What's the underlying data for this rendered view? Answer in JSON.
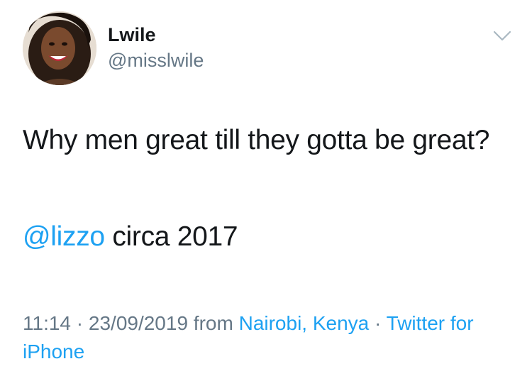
{
  "user": {
    "display_name": "Lwile",
    "handle": "@misslwile"
  },
  "tweet": {
    "text": "Why men great till they gotta be great?",
    "mention": "@lizzo",
    "mention_suffix": " circa 2017"
  },
  "meta": {
    "time": "11:14",
    "separator1": " · ",
    "date": "23/09/2019",
    "from_label": " from ",
    "location": "Nairobi, Kenya",
    "separator2": " · ",
    "client": "Twitter for iPhone"
  },
  "icons": {
    "menu": "chevron-down-icon"
  },
  "colors": {
    "text": "#14171a",
    "secondary": "#657786",
    "link": "#1da1f2"
  }
}
